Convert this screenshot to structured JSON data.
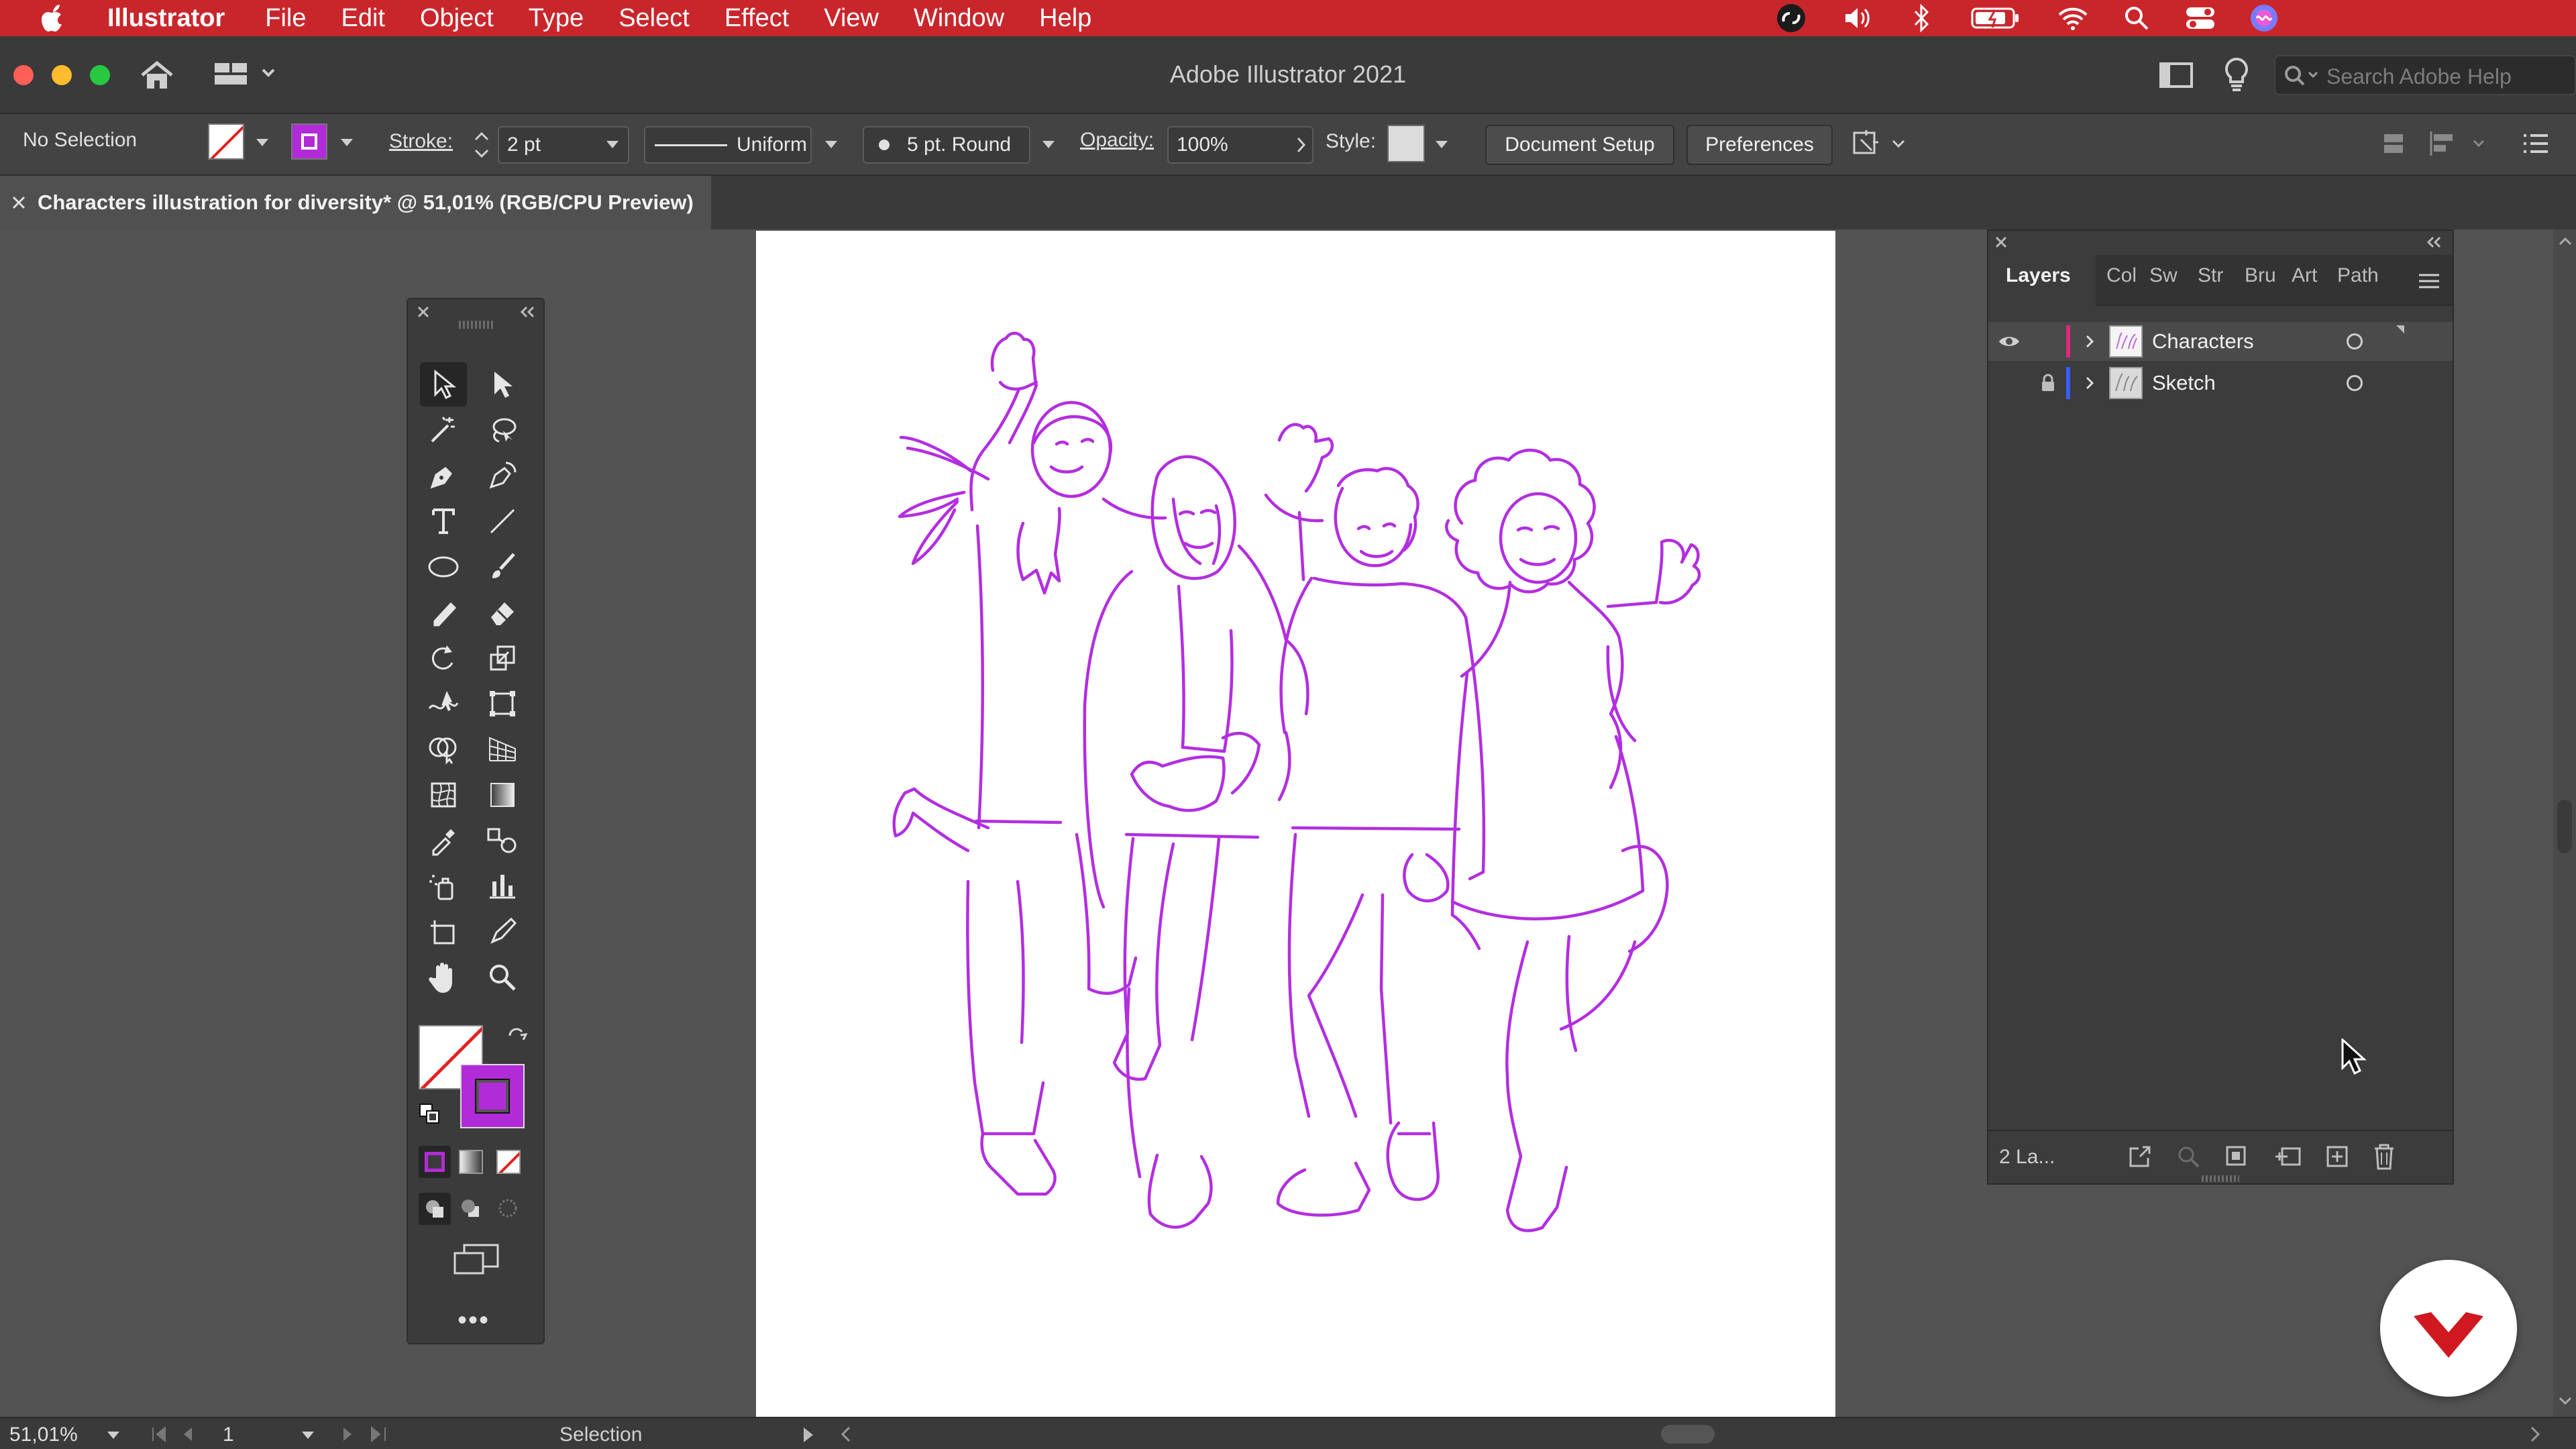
{
  "menubar": {
    "apple_icon": "apple-icon",
    "app_name": "Illustrator",
    "items": [
      "File",
      "Edit",
      "Object",
      "Type",
      "Select",
      "Effect",
      "View",
      "Window",
      "Help"
    ]
  },
  "titlebar": {
    "app_title": "Adobe Illustrator 2021",
    "search_placeholder": "Search Adobe Help"
  },
  "control_bar": {
    "selection_label": "No Selection",
    "stroke_label": "Stroke:",
    "stroke_weight": "2 pt",
    "profile_label": "Uniform",
    "brush_label": "5 pt. Round",
    "opacity_label": "Opacity:",
    "opacity_value": "100%",
    "style_label": "Style:",
    "document_setup_button": "Document Setup",
    "preferences_button": "Preferences"
  },
  "document_tab": {
    "title": "Characters illustration for diversity* @ 51,01% (RGB/CPU Preview)"
  },
  "layers_panel": {
    "tabs": [
      "Layers",
      "Col",
      "Sw",
      "Str",
      "Bru",
      "Art",
      "Path"
    ],
    "layers": [
      {
        "name": "Characters",
        "color": "#e0297b",
        "visible": true,
        "locked": false
      },
      {
        "name": "Sketch",
        "color": "#3a5dff",
        "visible": false,
        "locked": true
      }
    ],
    "layer_count": "2 La..."
  },
  "status_bar": {
    "zoom": "51,01%",
    "artboard_number": "1",
    "tool_name": "Selection"
  },
  "colors": {
    "menubar": "#c9262c",
    "stroke": "#b22bd8",
    "artwork_stroke": "#b32ee0",
    "layer_characters": "#e0297b",
    "layer_sketch": "#3a5dff"
  }
}
